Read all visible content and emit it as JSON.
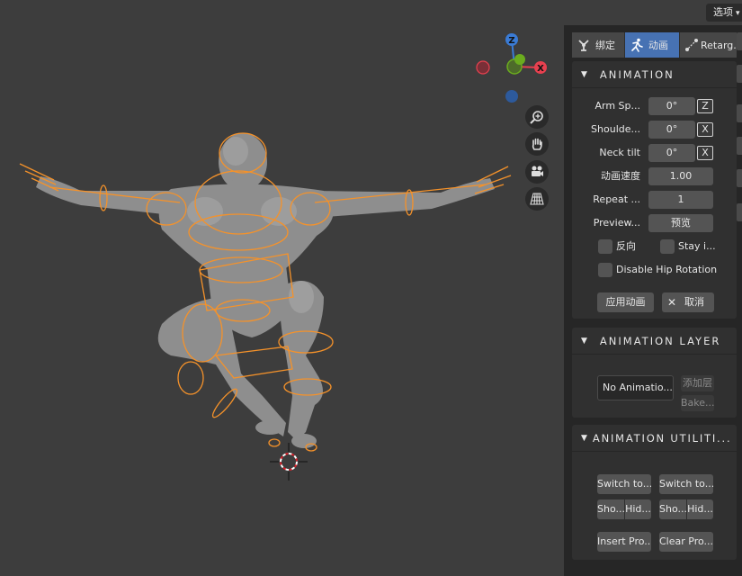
{
  "header": {
    "options_label": "选项"
  },
  "gizmo": {
    "z_label": "Z",
    "x_label": "X"
  },
  "tabs": [
    {
      "label": "绑定",
      "icon": "rig-icon",
      "active": false
    },
    {
      "label": "动画",
      "icon": "running-icon",
      "active": true
    },
    {
      "label": "Retarg...",
      "icon": "retarget-icon",
      "active": false
    }
  ],
  "animation": {
    "title": "ANIMATION",
    "arm_spin": {
      "label": "Arm Sp...",
      "value": "0°",
      "axis": "Z"
    },
    "shoulder": {
      "label": "Shoulde...",
      "value": "0°",
      "axis": "X"
    },
    "neck_tilt": {
      "label": "Neck tilt",
      "value": "0°",
      "axis": "X"
    },
    "speed": {
      "label": "动画速度",
      "value": "1.00"
    },
    "repeat": {
      "label": "Repeat ...",
      "value": "1"
    },
    "preview": {
      "label": "Preview...",
      "button": "预览"
    },
    "reverse": {
      "label": "反向",
      "checked": false
    },
    "stay": {
      "label": "Stay i...",
      "checked": false
    },
    "disable_hip": {
      "label": "Disable Hip Rotation",
      "checked": false
    },
    "apply_button": "应用动画",
    "cancel_button": "取消"
  },
  "animation_layer": {
    "title": "ANIMATION LAYER",
    "layer_select": "No Animatio...",
    "add_button": "添加层",
    "bake_button": "Bake..."
  },
  "animation_utilities": {
    "title": "ANIMATION UTILITI...",
    "switch_left": "Switch to...",
    "switch_right": "Switch to...",
    "show_left": "Sho...",
    "hide_left": "Hid...",
    "show_right": "Sho...",
    "hide_right": "Hid...",
    "insert_button": "Insert Pro...",
    "clear_button": "Clear Pro..."
  },
  "colors": {
    "accent": "#4772b3",
    "bone": "#f5922a",
    "axis_x": "#e8404f",
    "axis_y": "#6bac1e",
    "axis_z": "#3a7bd5",
    "viewport": "#3d3d3d"
  }
}
